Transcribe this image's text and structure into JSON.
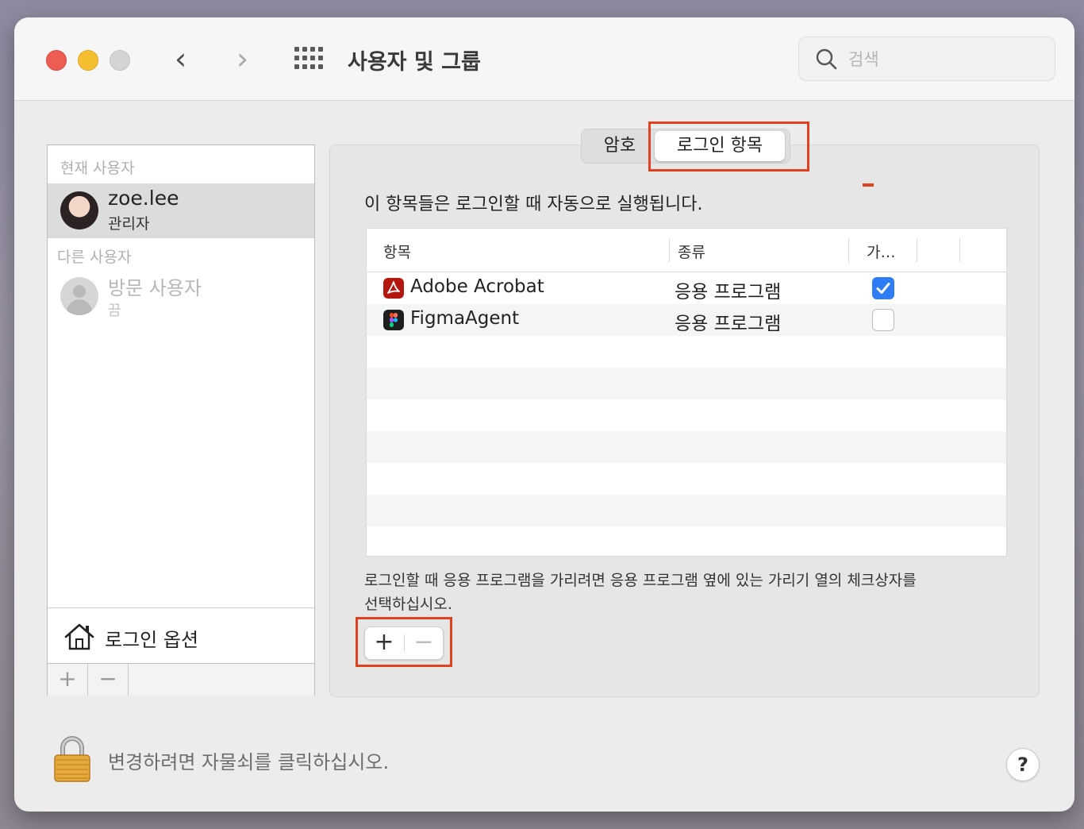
{
  "window": {
    "title": "사용자 및 그룹",
    "nav_back": "‹",
    "nav_forward": "›"
  },
  "search": {
    "placeholder": "검색",
    "icon": "search-icon"
  },
  "sidebar": {
    "current_section": "현재 사용자",
    "current_user": {
      "name": "zoe.lee",
      "role": "관리자"
    },
    "other_section": "다른 사용자",
    "guest_user": {
      "name": "방문 사용자",
      "status": "끔"
    },
    "login_options": "로그인 옵션",
    "add_label": "+",
    "remove_label": "−"
  },
  "tabs": [
    {
      "label": "암호",
      "selected": false
    },
    {
      "label": "로그인 항목",
      "selected": true
    }
  ],
  "main": {
    "description": "이 항목들은 로그인할 때 자동으로 실행됩니다.",
    "columns": [
      "항목",
      "종류",
      "가…"
    ],
    "rows": [
      {
        "name": "Adobe Acrobat",
        "kind": "응용 프로그램",
        "hide": true,
        "icon": "adobe-acrobat-icon"
      },
      {
        "name": "FigmaAgent",
        "kind": "응용 프로그램",
        "hide": false,
        "icon": "figma-icon"
      }
    ],
    "hint": "로그인할 때 응용 프로그램을 가리려면 응용 프로그램 옆에 있는 가리기 열의 체크상자를 선택하십시오.",
    "add_label": "+",
    "remove_label": "−"
  },
  "footer": {
    "lock_text": "변경하려면 자물쇠를 클릭하십시오.",
    "help_label": "?"
  },
  "colors": {
    "highlight": "#e0421f",
    "checkbox_on": "#2e7cf6"
  }
}
